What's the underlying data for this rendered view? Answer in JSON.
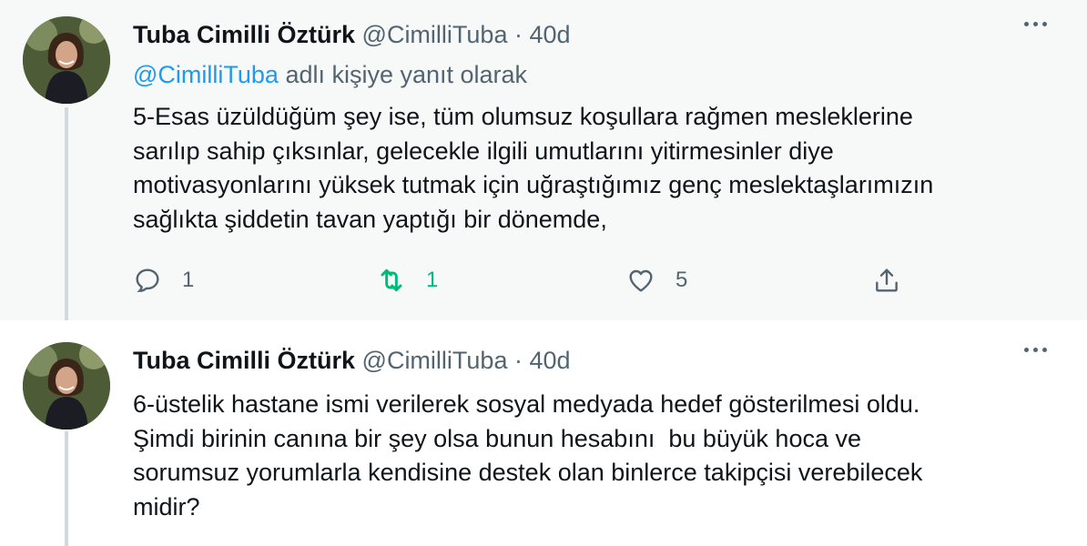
{
  "tweets": [
    {
      "author_name": "Tuba Cimilli Öztürk",
      "handle": "@CimilliTuba",
      "separator": "·",
      "time": "40d",
      "reply_mention": "@CimilliTuba",
      "reply_suffix": " adlı kişiye yanıt olarak",
      "text": "5-Esas üzüldüğüm şey ise, tüm olumsuz koşullara rağmen mesleklerine\nsarılıp sahip çıksınlar, gelecekle ilgili umutlarını yitirmesinler diye\nmotivasyonlarını yüksek tutmak için uğraştığımız genç meslektaşlarımızın\nsağlıkta şiddetin tavan yaptığı bir dönemde,",
      "reply_count": "1",
      "retweet_count": "1",
      "like_count": "5"
    },
    {
      "author_name": "Tuba Cimilli Öztürk",
      "handle": "@CimilliTuba",
      "separator": "·",
      "time": "40d",
      "text": "6-üstelik hastane ismi verilerek sosyal medyada hedef gösterilmesi oldu.\nŞimdi birinin canına bir şey olsa bunun hesabını  bu büyük hoca ve\nsorumsuz yorumlarla kendisine destek olan binlerce takipçisi verebilecek\nmidir?"
    }
  ],
  "icons": {
    "reply": "reply-icon",
    "retweet": "retweet-icon",
    "like": "heart-icon",
    "share": "share-icon",
    "more": "more-options-icon"
  },
  "colors": {
    "link": "#1d9bf0",
    "retweeted": "#00ba7c",
    "muted": "#536471",
    "text": "#0f1419",
    "highlight_bg": "#f7f9f9"
  }
}
